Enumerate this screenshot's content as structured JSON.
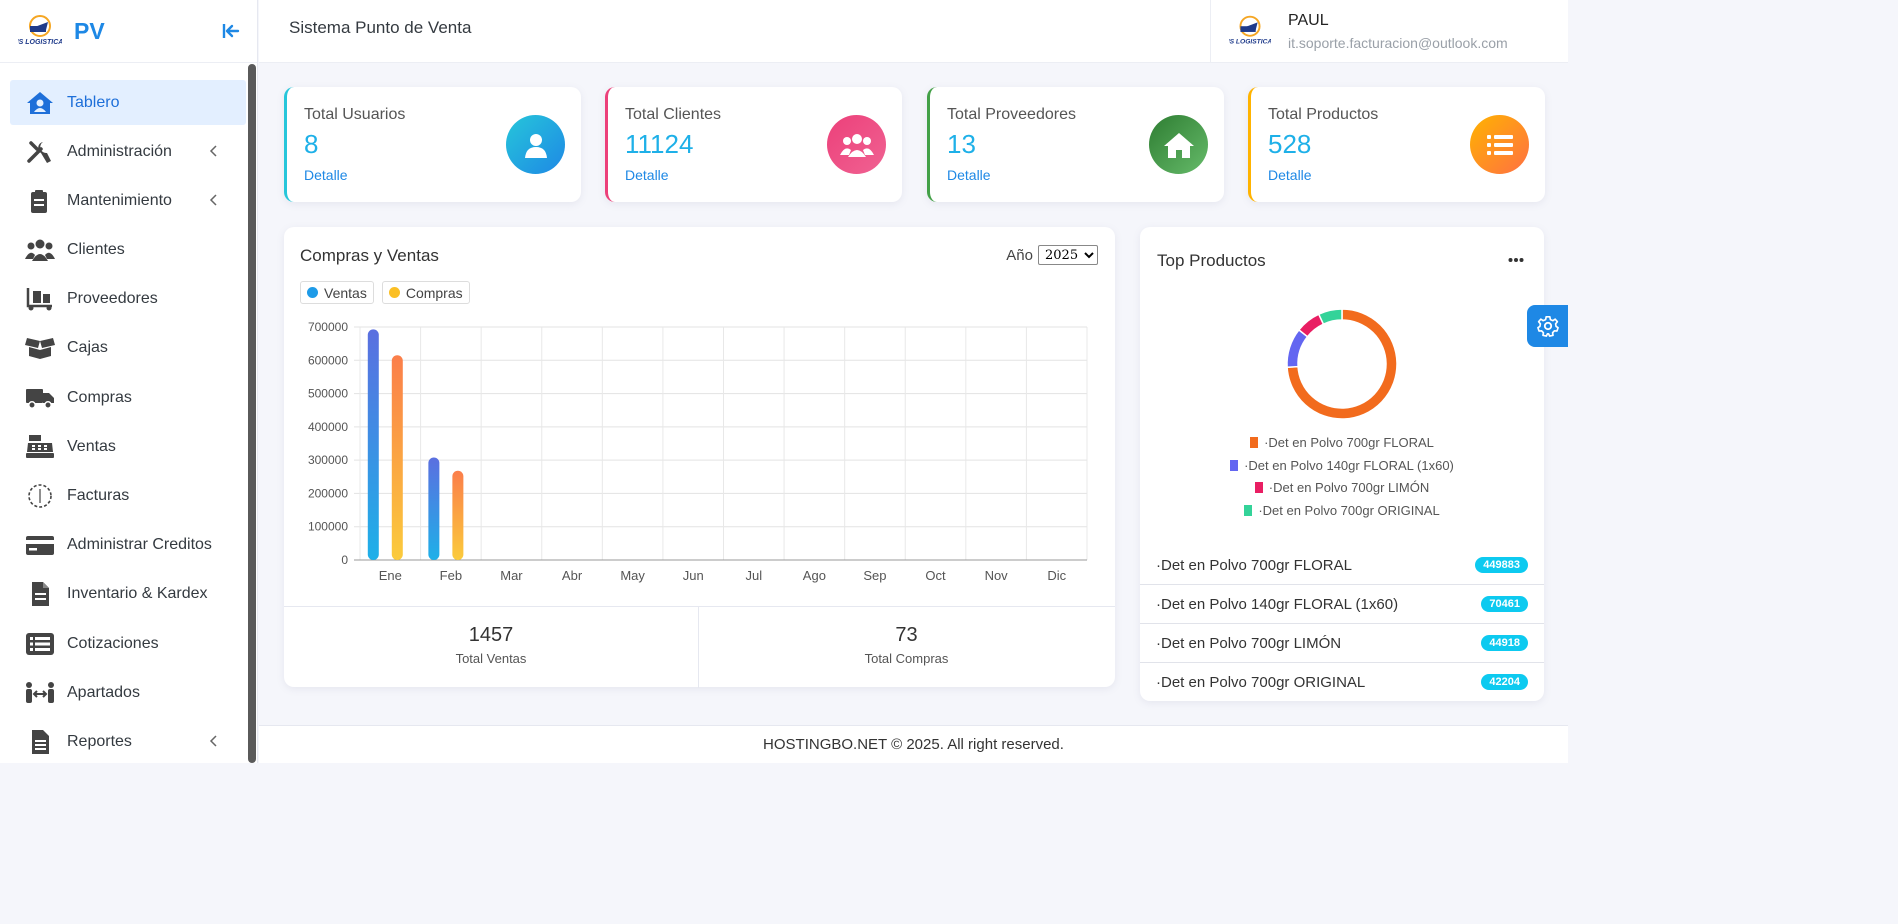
{
  "brand": {
    "name": "PV",
    "logo_text": "IS LOGISTICA"
  },
  "topbar": {
    "title": "Sistema Punto de Venta"
  },
  "user": {
    "name": "PAUL",
    "email": "it.soporte.facturacion@outlook.com"
  },
  "sidebar": {
    "items": [
      {
        "label": "Tablero",
        "icon": "home-user-icon",
        "active": true
      },
      {
        "label": "Administración",
        "icon": "tools-icon",
        "submenu": true
      },
      {
        "label": "Mantenimiento",
        "icon": "clipboard-icon",
        "submenu": true
      },
      {
        "label": "Clientes",
        "icon": "users-icon"
      },
      {
        "label": "Proveedores",
        "icon": "dolly-icon"
      },
      {
        "label": "Cajas",
        "icon": "box-open-icon"
      },
      {
        "label": "Compras",
        "icon": "truck-icon"
      },
      {
        "label": "Ventas",
        "icon": "cash-register-icon"
      },
      {
        "label": "Facturas",
        "icon": "circle-dashed-icon"
      },
      {
        "label": "Administrar Creditos",
        "icon": "credit-card-icon"
      },
      {
        "label": "Inventario & Kardex",
        "icon": "file-icon"
      },
      {
        "label": "Cotizaciones",
        "icon": "list-icon"
      },
      {
        "label": "Apartados",
        "icon": "people-arrows-icon"
      },
      {
        "label": "Reportes",
        "icon": "file-report-icon",
        "submenu": true
      }
    ]
  },
  "stats": [
    {
      "label": "Total Usuarios",
      "value": "8",
      "link": "Detalle",
      "color": "#26c6da",
      "icon": "user-icon"
    },
    {
      "label": "Total Clientes",
      "value": "11124",
      "link": "Detalle",
      "color": "#ec407a",
      "icon": "users-icon"
    },
    {
      "label": "Total Proveedores",
      "value": "13",
      "link": "Detalle",
      "color": "#43a047",
      "icon": "home-icon"
    },
    {
      "label": "Total Productos",
      "value": "528",
      "link": "Detalle",
      "color": "#ffb300",
      "icon": "list-icon"
    }
  ],
  "purchases_sales": {
    "title": "Compras y Ventas",
    "year_label": "Año",
    "year_value": "2025",
    "total_sales_value": "1457",
    "total_sales_label": "Total Ventas",
    "total_purchases_value": "73",
    "total_purchases_label": "Total Compras"
  },
  "chart_data": [
    {
      "type": "bar",
      "categories": [
        "Ene",
        "Feb",
        "Mar",
        "Abr",
        "May",
        "Jun",
        "Jul",
        "Ago",
        "Sep",
        "Oct",
        "Nov",
        "Dic"
      ],
      "series": [
        {
          "name": "Ventas",
          "values": [
            693000,
            308000,
            0,
            0,
            0,
            0,
            0,
            0,
            0,
            0,
            0,
            0
          ],
          "color": "#3a8ee6"
        },
        {
          "name": "Compras",
          "values": [
            615000,
            268000,
            0,
            0,
            0,
            0,
            0,
            0,
            0,
            0,
            0,
            0
          ],
          "color": "#fbbf24"
        }
      ],
      "yticks": [
        0,
        100000,
        200000,
        300000,
        400000,
        500000,
        600000,
        700000
      ],
      "ylim": [
        0,
        700000
      ],
      "grid": true,
      "legend": "top-left"
    },
    {
      "type": "pie",
      "title": "Top Productos",
      "labels": [
        "·Det en Polvo 700gr FLORAL",
        "·Det en Polvo 140gr FLORAL (1x60)",
        "·Det en Polvo 700gr LIMÓN",
        "·Det en Polvo 700gr ORIGINAL"
      ],
      "values": [
        449883,
        70461,
        44918,
        42204
      ],
      "colors": [
        "#f26b1d",
        "#6366f1",
        "#e91e63",
        "#34d399"
      ],
      "legend": "bottom"
    }
  ],
  "top_products": {
    "title": "Top Productos",
    "items": [
      {
        "name": "·Det en Polvo 700gr FLORAL",
        "qty": "449883"
      },
      {
        "name": "·Det en Polvo 140gr FLORAL (1x60)",
        "qty": "70461"
      },
      {
        "name": "·Det en Polvo 700gr LIMÓN",
        "qty": "44918"
      },
      {
        "name": "·Det en Polvo 700gr ORIGINAL",
        "qty": "42204"
      }
    ]
  },
  "footer": {
    "text": "HOSTINGBO.NET © 2025. All right reserved."
  }
}
